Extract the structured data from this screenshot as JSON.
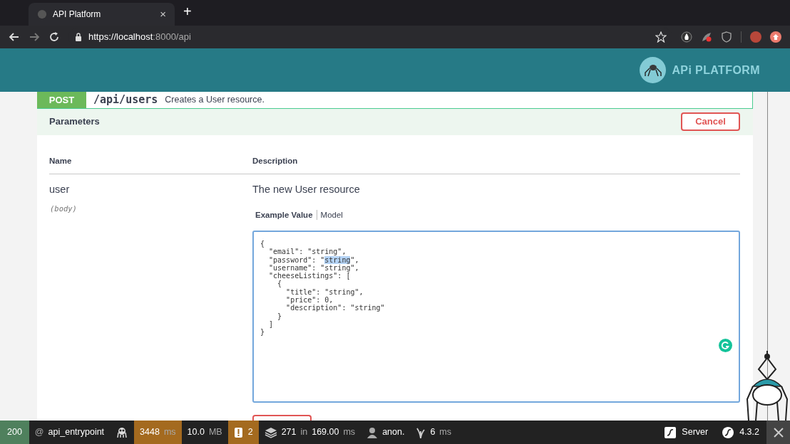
{
  "browser": {
    "tab": {
      "title": "API Platform",
      "close": "×"
    },
    "new_tab": "+",
    "url": {
      "host": "https://localhost",
      "rest": ":8000/api"
    }
  },
  "header": {
    "logo_text": "APi PLATFORM"
  },
  "operation": {
    "method": "POST",
    "path": "/api/users",
    "summary": "Creates a User resource."
  },
  "parameters": {
    "title": "Parameters",
    "cancel": "Cancel",
    "columns": [
      "Name",
      "Description"
    ],
    "rows": [
      {
        "name": "user",
        "location": "(body)",
        "description": "The new User resource",
        "tabs": [
          {
            "label": "Example Value",
            "selected": true
          },
          {
            "label": "Model",
            "selected": false
          }
        ],
        "example_lines": [
          {
            "text": "{"
          },
          {
            "text": "  \"email\": \"string\","
          },
          {
            "text": "  \"password\": \"",
            "highlighted": "string",
            "after": "\","
          },
          {
            "text": "  \"username\": \"string\","
          },
          {
            "text": "  \"cheeseListings\": ["
          },
          {
            "text": "    {"
          },
          {
            "text": "      \"title\": \"string\","
          },
          {
            "text": "      \"price\": 0,"
          },
          {
            "text": "      \"description\": \"string\""
          },
          {
            "text": "    }"
          },
          {
            "text": "  ]"
          },
          {
            "text": "}"
          }
        ]
      }
    ]
  },
  "toolbar": {
    "left": [
      {
        "kind": "status",
        "parts": [
          {
            "text": "200",
            "muted": false
          }
        ]
      },
      {
        "kind": "route",
        "parts": [
          {
            "text": "@",
            "muted": true
          },
          {
            "text": "api_entrypoint",
            "muted": false
          }
        ]
      },
      {
        "kind": "ghost"
      },
      {
        "kind": "time",
        "warn": true,
        "parts": [
          {
            "text": "3448",
            "muted": false
          },
          {
            "text": "ms",
            "muted": true
          }
        ]
      },
      {
        "kind": "memory",
        "warn": false,
        "parts": [
          {
            "text": "10.0",
            "muted": false
          },
          {
            "text": "MB",
            "muted": true
          }
        ]
      },
      {
        "kind": "alerts",
        "warn": true,
        "parts": [
          {
            "text": "2",
            "muted": false
          }
        ]
      },
      {
        "kind": "cache",
        "warn": false,
        "parts": [
          {
            "text": "271",
            "muted": false
          },
          {
            "text": "in",
            "muted": true
          },
          {
            "text": "169.00",
            "muted": false
          },
          {
            "text": "ms",
            "muted": true
          }
        ]
      },
      {
        "kind": "user",
        "warn": false,
        "parts": [
          {
            "text": "anon.",
            "muted": false
          }
        ]
      },
      {
        "kind": "twig",
        "warn": false,
        "parts": [
          {
            "text": "6",
            "muted": false
          },
          {
            "text": "ms",
            "muted": true
          }
        ]
      }
    ],
    "right": [
      {
        "kind": "server",
        "text": "Server"
      },
      {
        "kind": "version",
        "text": "4.3.2"
      }
    ]
  }
}
